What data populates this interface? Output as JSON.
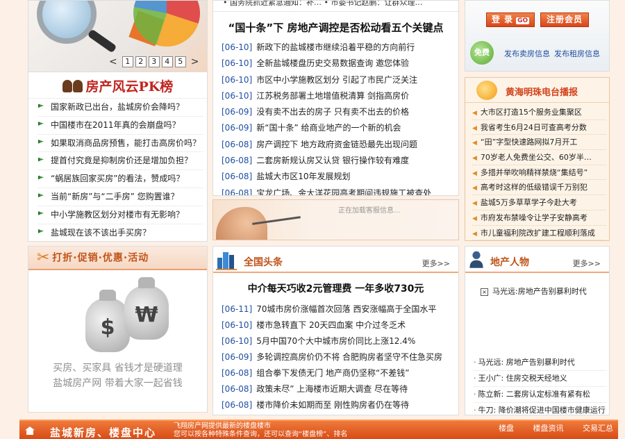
{
  "banner": {
    "pager": [
      "1",
      "2",
      "3",
      "4",
      "5"
    ],
    "prev": "<",
    "next": ">"
  },
  "pk": {
    "title": "房产风云PK榜",
    "items": [
      "国家新政已出台，盐城房价会降吗？",
      "中国楼市在2011年真的会崩盘吗？",
      "如果取消商品房预售，能打击高房价吗？",
      "提首付究竟是抑制房价还是增加负担？",
      "“蜗居族回家买房”的看法，赞成吗？",
      "当前“新房”与“二手房” 您购置谁？",
      "中小学施教区划分对楼市有无影响？",
      "盐城现在该不该出手买房？"
    ]
  },
  "promo": {
    "title": "打折·促销·优惠·活动",
    "bag1": "$",
    "bag2": "₩",
    "line1": "买房、买家具 省钱才是硬道理",
    "line2": "盐城房产网 带着大家一起省钱"
  },
  "news1": {
    "topline": "• 国务院抓近紧急通知：补…    • 市委书记赵鹏：让群众理…",
    "headline": "“国十条”下 房地产调控是否松动看五个关键点",
    "items": [
      {
        "date": "[06-10]",
        "text": "新政下的盐城楼市继续沿着平稳的方向前行"
      },
      {
        "date": "[06-10]",
        "text": "全新盐城楼盘历史交易数据查询 邀您体验"
      },
      {
        "date": "[06-10]",
        "text": "市区中小学施教区划分 引起了市民广泛关注"
      },
      {
        "date": "[06-10]",
        "text": "江苏税务部署土地增值税清算 剑指高房价"
      },
      {
        "date": "[06-09]",
        "text": "没有卖不出去的房子 只有卖不出去的价格"
      },
      {
        "date": "[06-09]",
        "text": "新“国十条” 给商业地产的一个新的机会"
      },
      {
        "date": "[06-08]",
        "text": "房产调控下 地方政府资金链恐最先出现问题"
      },
      {
        "date": "[06-08]",
        "text": "二套房新规认房又认贷 银行操作较有难度"
      },
      {
        "date": "[06-08]",
        "text": "盐城大市区10年发展规划"
      },
      {
        "date": "[06-08]",
        "text": "宝龙广场、金大洋花园高考期间违规施工被查处"
      }
    ]
  },
  "support": {
    "loading": "正在加载客服信息..."
  },
  "national": {
    "title": "全国头条",
    "more": "更多>>",
    "headline": "中介每天巧收2元管理费 一年多收730元",
    "items": [
      {
        "date": "[06-11]",
        "text": "70城市房价涨幅首次回落 西安涨幅高于全国水平"
      },
      {
        "date": "[06-10]",
        "text": "楼市急转直下 20天四血案 中介过冬乏术"
      },
      {
        "date": "[06-10]",
        "text": "5月中国70个大中城市房价同比上涨12.4%"
      },
      {
        "date": "[06-09]",
        "text": "多轮调控高房价仍不将 合肥购房者坚守不住急买房"
      },
      {
        "date": "[06-08]",
        "text": "组合拳下发债无门 地产商仍坚称“不差钱”"
      },
      {
        "date": "[06-08]",
        "text": "政策未尽” 上海楼市近期大调查 尽在等待"
      },
      {
        "date": "[06-08]",
        "text": "楼市降价未如期而至 刚性购房者仍在等待"
      }
    ]
  },
  "login": {
    "login_label": "登 录",
    "go": "GO",
    "register_label": "注册会员",
    "free": "免费",
    "sell": "发布卖房信息",
    "rent": "发布租房信息"
  },
  "radio": {
    "title": "黄海明珠电台播报",
    "items": [
      "大市区打造15个服务业集聚区",
      "我省考生6月24日可查高考分数",
      "“田”字型快速路网拟7月开工",
      "70岁老人免费坐公交、60岁半…",
      "多措并举吹响精祥禁烧“集结号”",
      "高考时这样的低级错误千万别犯",
      "盐城5万多草草学子今赴大考",
      "市府发布禁噪令让学子安静高考",
      "市儿童福利院改扩建工程顺利落成"
    ]
  },
  "people": {
    "title": "地产人物",
    "more": "更多>>",
    "featured": "马光远:房地产告别暴利时代",
    "items": [
      "马光远: 房地产告别暴利时代",
      "王小广: 住房交税天经地义",
      "陈立新: 二套房认定标准有紧有松",
      "牛刀: 降价潮将促进中国楼市健康运行"
    ]
  },
  "bottom": {
    "title": "盐城新房、楼盘中心",
    "desc1": "飞翔房产网提供最新的楼盘楼市",
    "desc2": "您可以按各种特殊条件查询，还可以查询“楼盘榜”、排名",
    "links": [
      "楼盘",
      "楼盘资讯",
      "交易汇总"
    ]
  }
}
